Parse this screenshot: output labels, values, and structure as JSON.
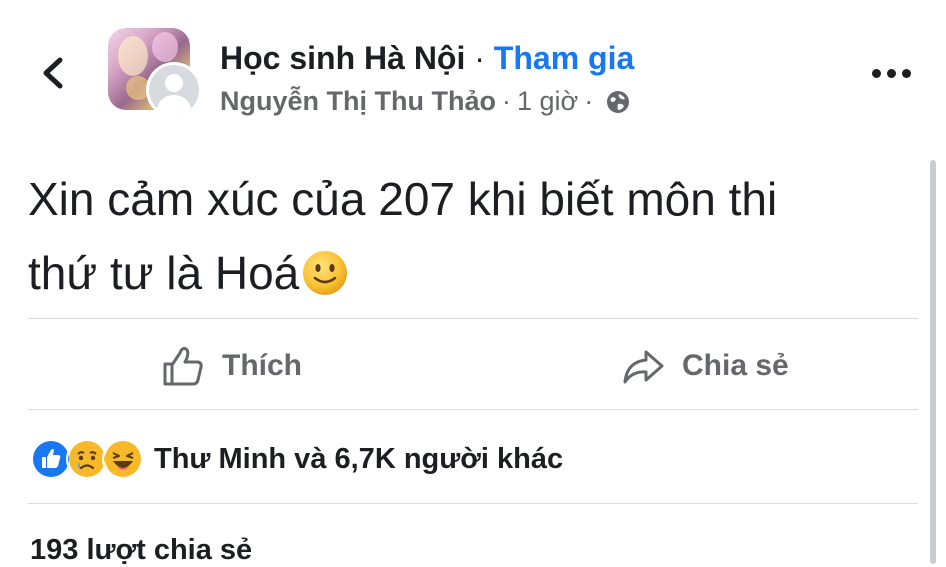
{
  "header": {
    "group_name": "Học sinh Hà Nội",
    "title_separator": "·",
    "join_label": "Tham gia",
    "author": "Nguyễn Thị Thu Thảo",
    "meta_separator": "·",
    "time": "1 giờ",
    "meta_separator_2": "·",
    "privacy_icon": "globe-icon",
    "back_icon": "chevron-left-icon",
    "more_icon": "more-horizontal-icon"
  },
  "post": {
    "line1": "Xin cảm xúc của 207 khi biết môn thi",
    "line2": "thứ tư là Hoá",
    "emoji": "slightly-smiling-face-emoji"
  },
  "actions": {
    "like_label": "Thích",
    "share_label": "Chia sẻ",
    "like_icon": "thumbs-up-icon",
    "share_icon": "share-arrow-icon"
  },
  "reactions": {
    "icons": [
      "like-reaction-icon",
      "sad-reaction-icon",
      "haha-reaction-icon"
    ],
    "summary": "Thư Minh và 6,7K người khác"
  },
  "shares": {
    "text": "193 lượt chia sẻ"
  },
  "colors": {
    "accent": "#1877f2",
    "secondary_text": "#65676b",
    "divider": "#dadde1"
  }
}
